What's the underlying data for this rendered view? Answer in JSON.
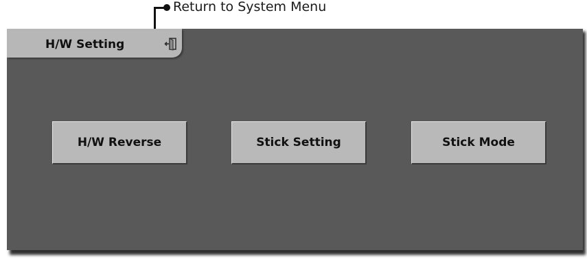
{
  "callout": {
    "text": "Return to System Menu"
  },
  "screen": {
    "title": "H/W Setting",
    "return_icon": "return-door-icon",
    "buttons": [
      {
        "label": "H/W Reverse"
      },
      {
        "label": "Stick Setting"
      },
      {
        "label": "Stick Mode"
      }
    ]
  },
  "colors": {
    "screen_bg": "#595959",
    "button_bg": "#b9b9b9",
    "tab_bg": "#b7b7b7"
  }
}
